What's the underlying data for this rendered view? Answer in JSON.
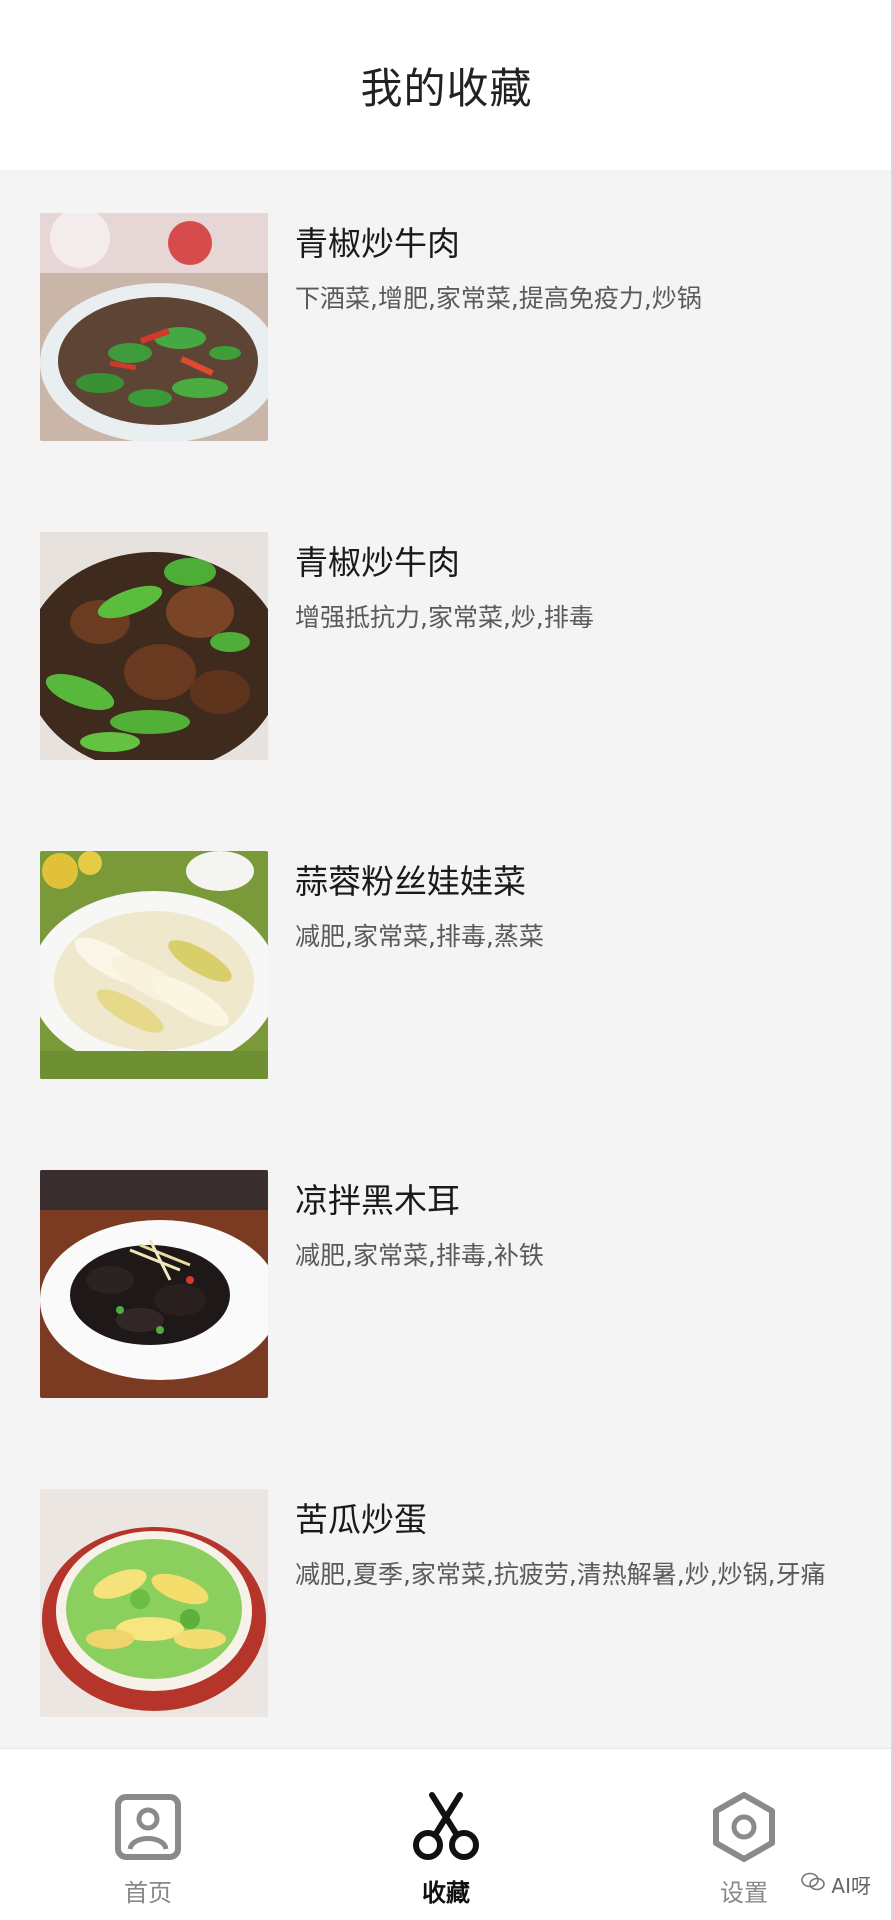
{
  "header": {
    "title": "我的收藏"
  },
  "favorites": [
    {
      "title": "青椒炒牛肉",
      "tags": "下酒菜,增肥,家常菜,提高免疫力,炒锅"
    },
    {
      "title": "青椒炒牛肉",
      "tags": "增强抵抗力,家常菜,炒,排毒"
    },
    {
      "title": "蒜蓉粉丝娃娃菜",
      "tags": "减肥,家常菜,排毒,蒸菜"
    },
    {
      "title": "凉拌黑木耳",
      "tags": "减肥,家常菜,排毒,补铁"
    },
    {
      "title": "苦瓜炒蛋",
      "tags": "减肥,夏季,家常菜,抗疲劳,清热解暑,炒,炒锅,牙痛"
    }
  ],
  "tabbar": {
    "tabs": [
      {
        "label": "首页",
        "icon": "home-person-icon",
        "active": false
      },
      {
        "label": "收藏",
        "icon": "scissors-icon",
        "active": true
      },
      {
        "label": "设置",
        "icon": "hex-nut-icon",
        "active": false
      }
    ]
  },
  "watermark": {
    "text": "AI呀",
    "icon": "wechat-icon"
  },
  "colors": {
    "background": "#f4f4f4",
    "header_bg": "#ffffff",
    "active_tab": "#111111",
    "inactive_tab": "#888888"
  }
}
